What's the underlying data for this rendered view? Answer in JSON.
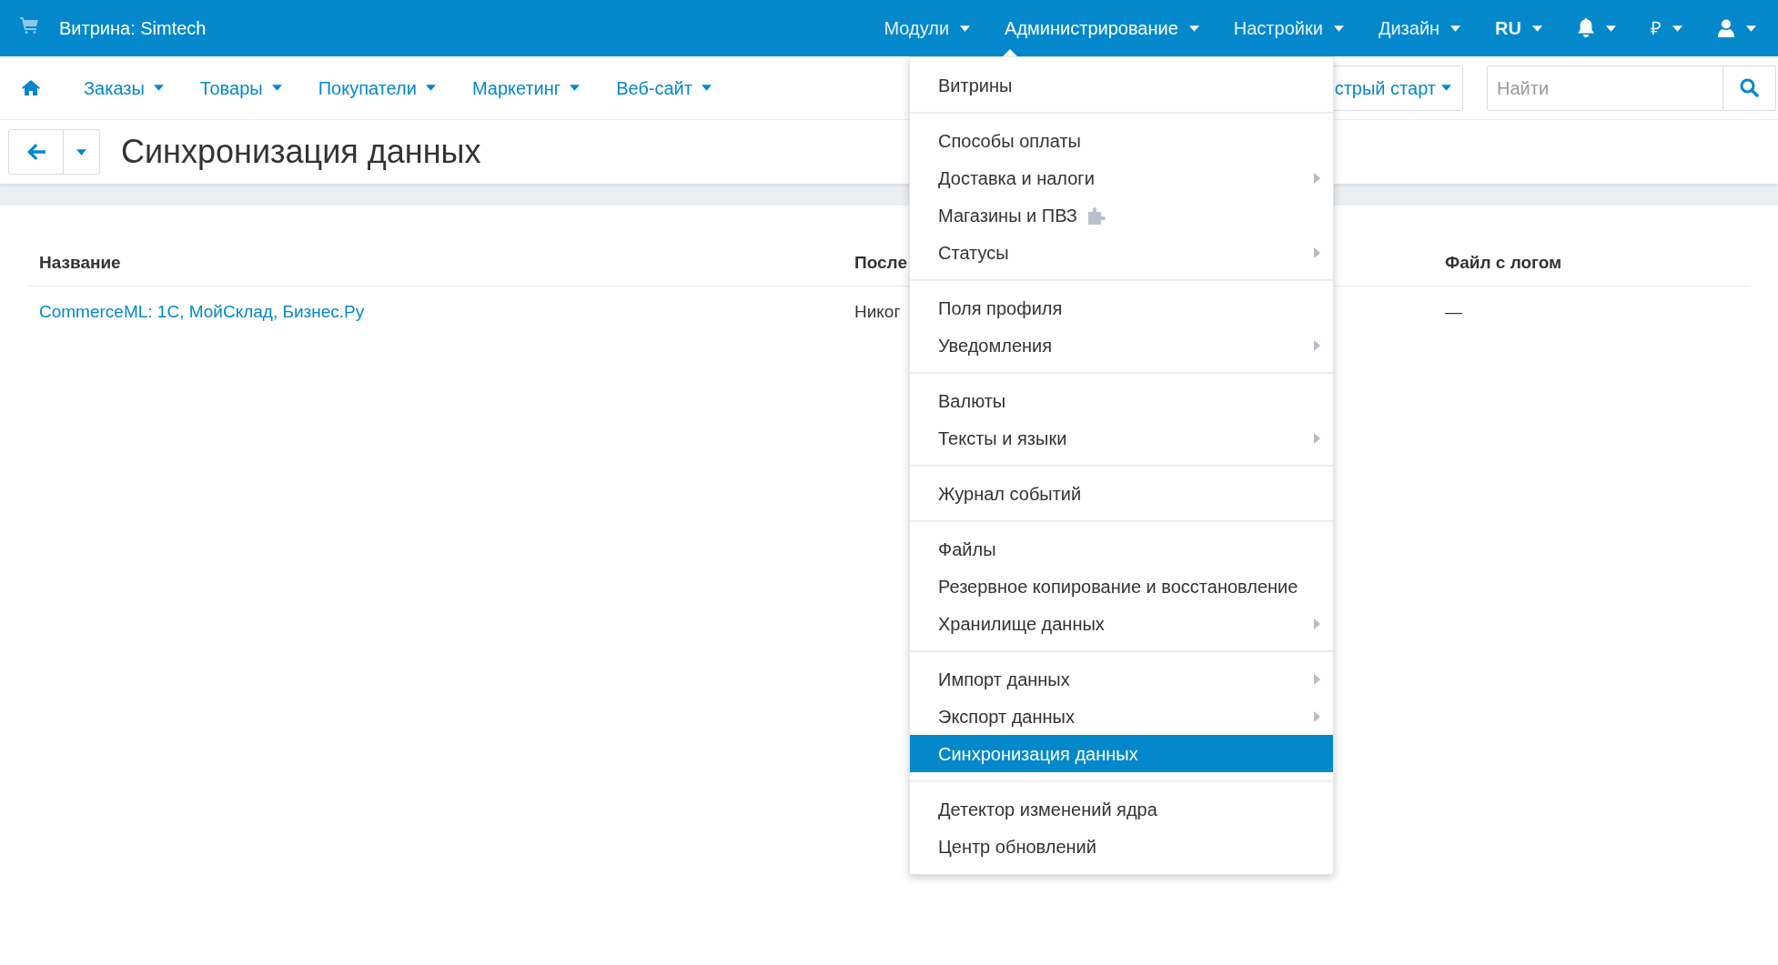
{
  "top_bar": {
    "storefront": "Витрина: Simtech",
    "menu": [
      {
        "kind": "menu",
        "label": "Модули",
        "expanded": false
      },
      {
        "kind": "menu",
        "label": "Администрирование",
        "expanded": true
      },
      {
        "kind": "menu",
        "label": "Настройки",
        "expanded": false
      },
      {
        "kind": "menu",
        "label": "Дизайн",
        "expanded": false
      },
      {
        "kind": "language",
        "label": "RU",
        "expanded": false
      },
      {
        "kind": "bell",
        "expanded": false
      },
      {
        "kind": "menu",
        "label": "₽",
        "expanded": false
      },
      {
        "kind": "user",
        "expanded": false
      }
    ]
  },
  "nav": {
    "items": [
      "Заказы",
      "Товары",
      "Покупатели",
      "Маркетинг",
      "Веб-сайт"
    ],
    "quick_start": "стрый старт",
    "search": {
      "placeholder": "Найти"
    }
  },
  "page": {
    "title": "Синхронизация данных"
  },
  "table": {
    "columns": [
      "Название",
      "После",
      "Файл с логом"
    ],
    "rows": [
      {
        "name": "CommerceML: 1С, МойСклад, Бизнес.Ру",
        "last": "Никог",
        "log": "—"
      }
    ]
  },
  "dropdown": {
    "groups": [
      [
        {
          "label": "Витрины",
          "submenu": false,
          "addon": false,
          "selected": false
        }
      ],
      [
        {
          "label": "Способы оплаты",
          "submenu": false,
          "addon": false,
          "selected": false
        },
        {
          "label": "Доставка и налоги",
          "submenu": true,
          "addon": false,
          "selected": false
        },
        {
          "label": "Магазины и ПВЗ",
          "submenu": false,
          "addon": true,
          "selected": false
        },
        {
          "label": "Статусы",
          "submenu": true,
          "addon": false,
          "selected": false
        }
      ],
      [
        {
          "label": "Поля профиля",
          "submenu": false,
          "addon": false,
          "selected": false
        },
        {
          "label": "Уведомления",
          "submenu": true,
          "addon": false,
          "selected": false
        }
      ],
      [
        {
          "label": "Валюты",
          "submenu": false,
          "addon": false,
          "selected": false
        },
        {
          "label": "Тексты и языки",
          "submenu": true,
          "addon": false,
          "selected": false
        }
      ],
      [
        {
          "label": "Журнал событий",
          "submenu": false,
          "addon": false,
          "selected": false
        }
      ],
      [
        {
          "label": "Файлы",
          "submenu": false,
          "addon": false,
          "selected": false
        },
        {
          "label": "Резервное копирование и восстановление",
          "submenu": false,
          "addon": false,
          "selected": false
        },
        {
          "label": "Хранилище данных",
          "submenu": true,
          "addon": false,
          "selected": false
        }
      ],
      [
        {
          "label": "Импорт данных",
          "submenu": true,
          "addon": false,
          "selected": false
        },
        {
          "label": "Экспорт данных",
          "submenu": true,
          "addon": false,
          "selected": false
        },
        {
          "label": "Синхронизация данных",
          "submenu": false,
          "addon": false,
          "selected": true
        }
      ],
      [
        {
          "label": "Детектор изменений ядра",
          "submenu": false,
          "addon": false,
          "selected": false
        },
        {
          "label": "Центр обновлений",
          "submenu": false,
          "addon": false,
          "selected": false
        }
      ]
    ]
  }
}
